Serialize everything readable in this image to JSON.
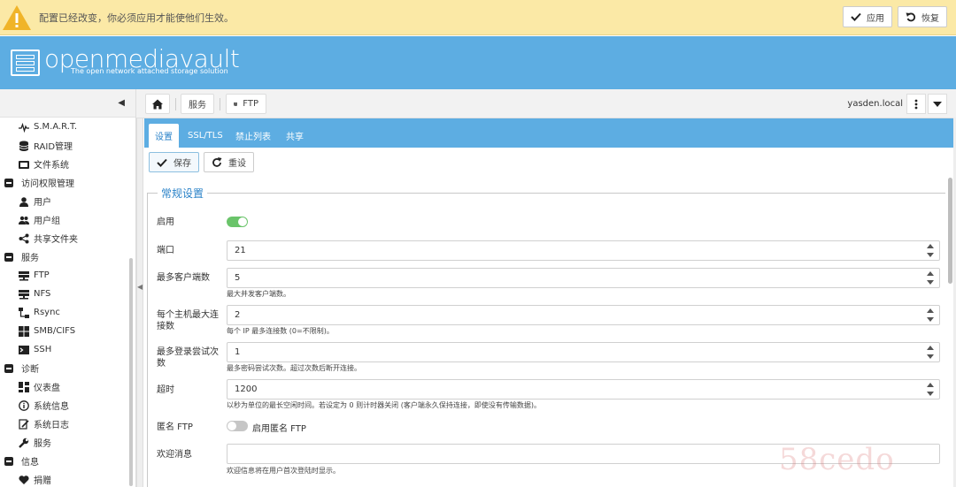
{
  "notification": {
    "text": "配置已经改变，你必须应用才能使他们生效。",
    "apply_label": "应用",
    "revert_label": "恢复"
  },
  "brand": {
    "name": "openmediavault",
    "tagline": "The open network attached storage solution"
  },
  "sidebar": {
    "items": [
      {
        "label": "S.M.A.R.T.",
        "icon": "pulse-icon"
      },
      {
        "label": "RAID管理",
        "icon": "database-icon"
      },
      {
        "label": "文件系统",
        "icon": "folder-icon"
      },
      {
        "label": "访问权限管理",
        "group": true
      },
      {
        "label": "用户",
        "icon": "user-icon"
      },
      {
        "label": "用户组",
        "icon": "users-icon"
      },
      {
        "label": "共享文件夹",
        "icon": "share-icon"
      },
      {
        "label": "服务",
        "group": true
      },
      {
        "label": "FTP",
        "icon": "server-icon"
      },
      {
        "label": "NFS",
        "icon": "server-icon"
      },
      {
        "label": "Rsync",
        "icon": "sitemap-icon"
      },
      {
        "label": "SMB/CIFS",
        "icon": "windows-icon"
      },
      {
        "label": "SSH",
        "icon": "terminal-icon"
      },
      {
        "label": "诊断",
        "group": true
      },
      {
        "label": "仪表盘",
        "icon": "dashboard-icon"
      },
      {
        "label": "系统信息",
        "icon": "info-icon"
      },
      {
        "label": "系统日志",
        "icon": "log-icon"
      },
      {
        "label": "服务",
        "icon": "wrench-icon"
      },
      {
        "label": "信息",
        "group": true
      },
      {
        "label": "捐赠",
        "icon": "heart-icon"
      }
    ]
  },
  "breadcrumb": {
    "services": "服务",
    "ftp": "FTP"
  },
  "hostname": "yasden.local",
  "tabs": [
    "设置",
    "SSL/TLS",
    "禁止列表",
    "共享"
  ],
  "actions": {
    "save": "保存",
    "reset": "重设"
  },
  "form": {
    "legend": "常规设置",
    "enable_label": "启用",
    "port_label": "端口",
    "port_value": "21",
    "max_clients_label": "最多客户端数",
    "max_clients_value": "5",
    "max_clients_hint": "最大并发客户端数。",
    "max_per_host_label": "每个主机最大连接数",
    "max_per_host_value": "2",
    "max_per_host_hint": "每个 IP 最多连接数 (0=不限制)。",
    "max_login_label": "最多登录尝试次数",
    "max_login_value": "1",
    "max_login_hint": "最多密码尝试次数。超过次数后断开连接。",
    "timeout_label": "超时",
    "timeout_value": "1200",
    "timeout_hint": "以秒为单位的最长空闲时间。若设定为 0 则计时器关闭 (客户端永久保持连接，即使没有传输数据)。",
    "anon_label": "匿名 FTP",
    "anon_toggle_label": "启用匿名 FTP",
    "welcome_label": "欢迎消息",
    "welcome_value": "",
    "welcome_hint": "欢迎信息将在用户首次登陆时显示。"
  },
  "watermark": "58cedo"
}
